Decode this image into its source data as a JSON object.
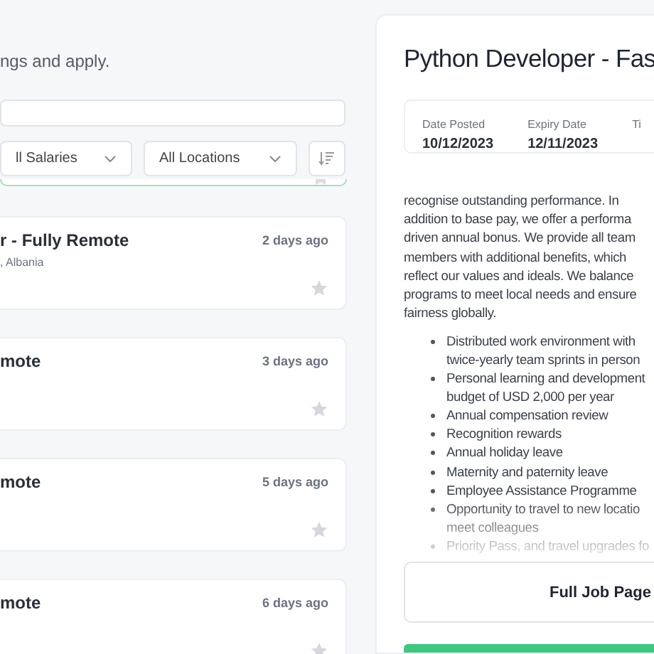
{
  "intro": "ngs and apply.",
  "filters": {
    "salary": "ll Salaries",
    "location": "All Locations"
  },
  "jobs": [
    {
      "title": "r - Fully Remote",
      "location": ", Albania",
      "posted": "2 days ago",
      "starred": false
    },
    {
      "title": "mote",
      "posted": "3 days ago",
      "starred": false
    },
    {
      "title": "mote",
      "posted": "5 days ago",
      "starred": false
    },
    {
      "title": "mote",
      "posted": "6 days ago",
      "starred": false
    }
  ],
  "detail": {
    "title": "Python Developer - Fas",
    "facts": [
      {
        "label": "Date Posted",
        "value": "10/12/2023"
      },
      {
        "label": "Expiry Date",
        "value": "12/11/2023"
      },
      {
        "label": "Ti"
      }
    ],
    "description": [
      "recognise outstanding performance. In",
      "addition to base pay, we offer a performa",
      "driven annual bonus. We provide all team",
      "members with additional benefits, which",
      "reflect our values and ideals. We balance",
      "programs to meet local needs and ensure",
      "fairness globally."
    ],
    "benefits": [
      [
        "Distributed work environment with",
        "twice-yearly team sprints in person"
      ],
      [
        "Personal learning and development",
        "budget of USD 2,000 per year"
      ],
      [
        "Annual compensation review"
      ],
      [
        "Recognition rewards"
      ],
      [
        "Annual holiday leave"
      ],
      [
        "Maternity and paternity leave"
      ],
      [
        "Employee Assistance Programme"
      ],
      [
        "Opportunity to travel to new locatio",
        "meet colleagues"
      ],
      [
        "Priority Pass, and travel upgrades fo"
      ]
    ],
    "button": "Full Job Page"
  }
}
